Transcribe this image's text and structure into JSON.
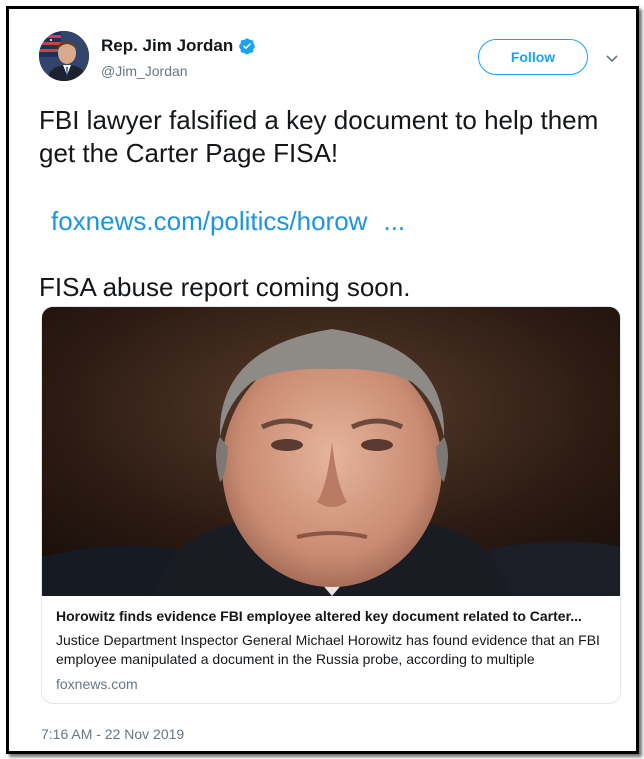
{
  "author": {
    "display_name": "Rep. Jim Jordan",
    "handle": "@Jim_Jordan",
    "verified": true
  },
  "actions": {
    "follow_label": "Follow"
  },
  "tweet": {
    "text": "FBI lawyer falsified a key document to help them get the Carter Page FISA!",
    "link_text": "foxnews.com/politics/horow",
    "link_ellipsis": "...",
    "text2": "FISA abuse report coming soon.",
    "timestamp": "7:16 AM - 22 Nov 2019"
  },
  "card": {
    "title": "Horowitz finds evidence FBI employee altered key document related to Carter...",
    "description": "Justice Department Inspector General Michael Horowitz has found evidence that an FBI employee manipulated a document in the Russia probe, according to multiple",
    "domain": "foxnews.com"
  },
  "icons": {
    "verified": "verified-badge-icon",
    "caret": "chevron-down-icon"
  },
  "colors": {
    "accent": "#1da1f2",
    "link": "#1b95e0",
    "text": "#14171a",
    "secondary": "#657786",
    "border": "#e1e8ed"
  }
}
